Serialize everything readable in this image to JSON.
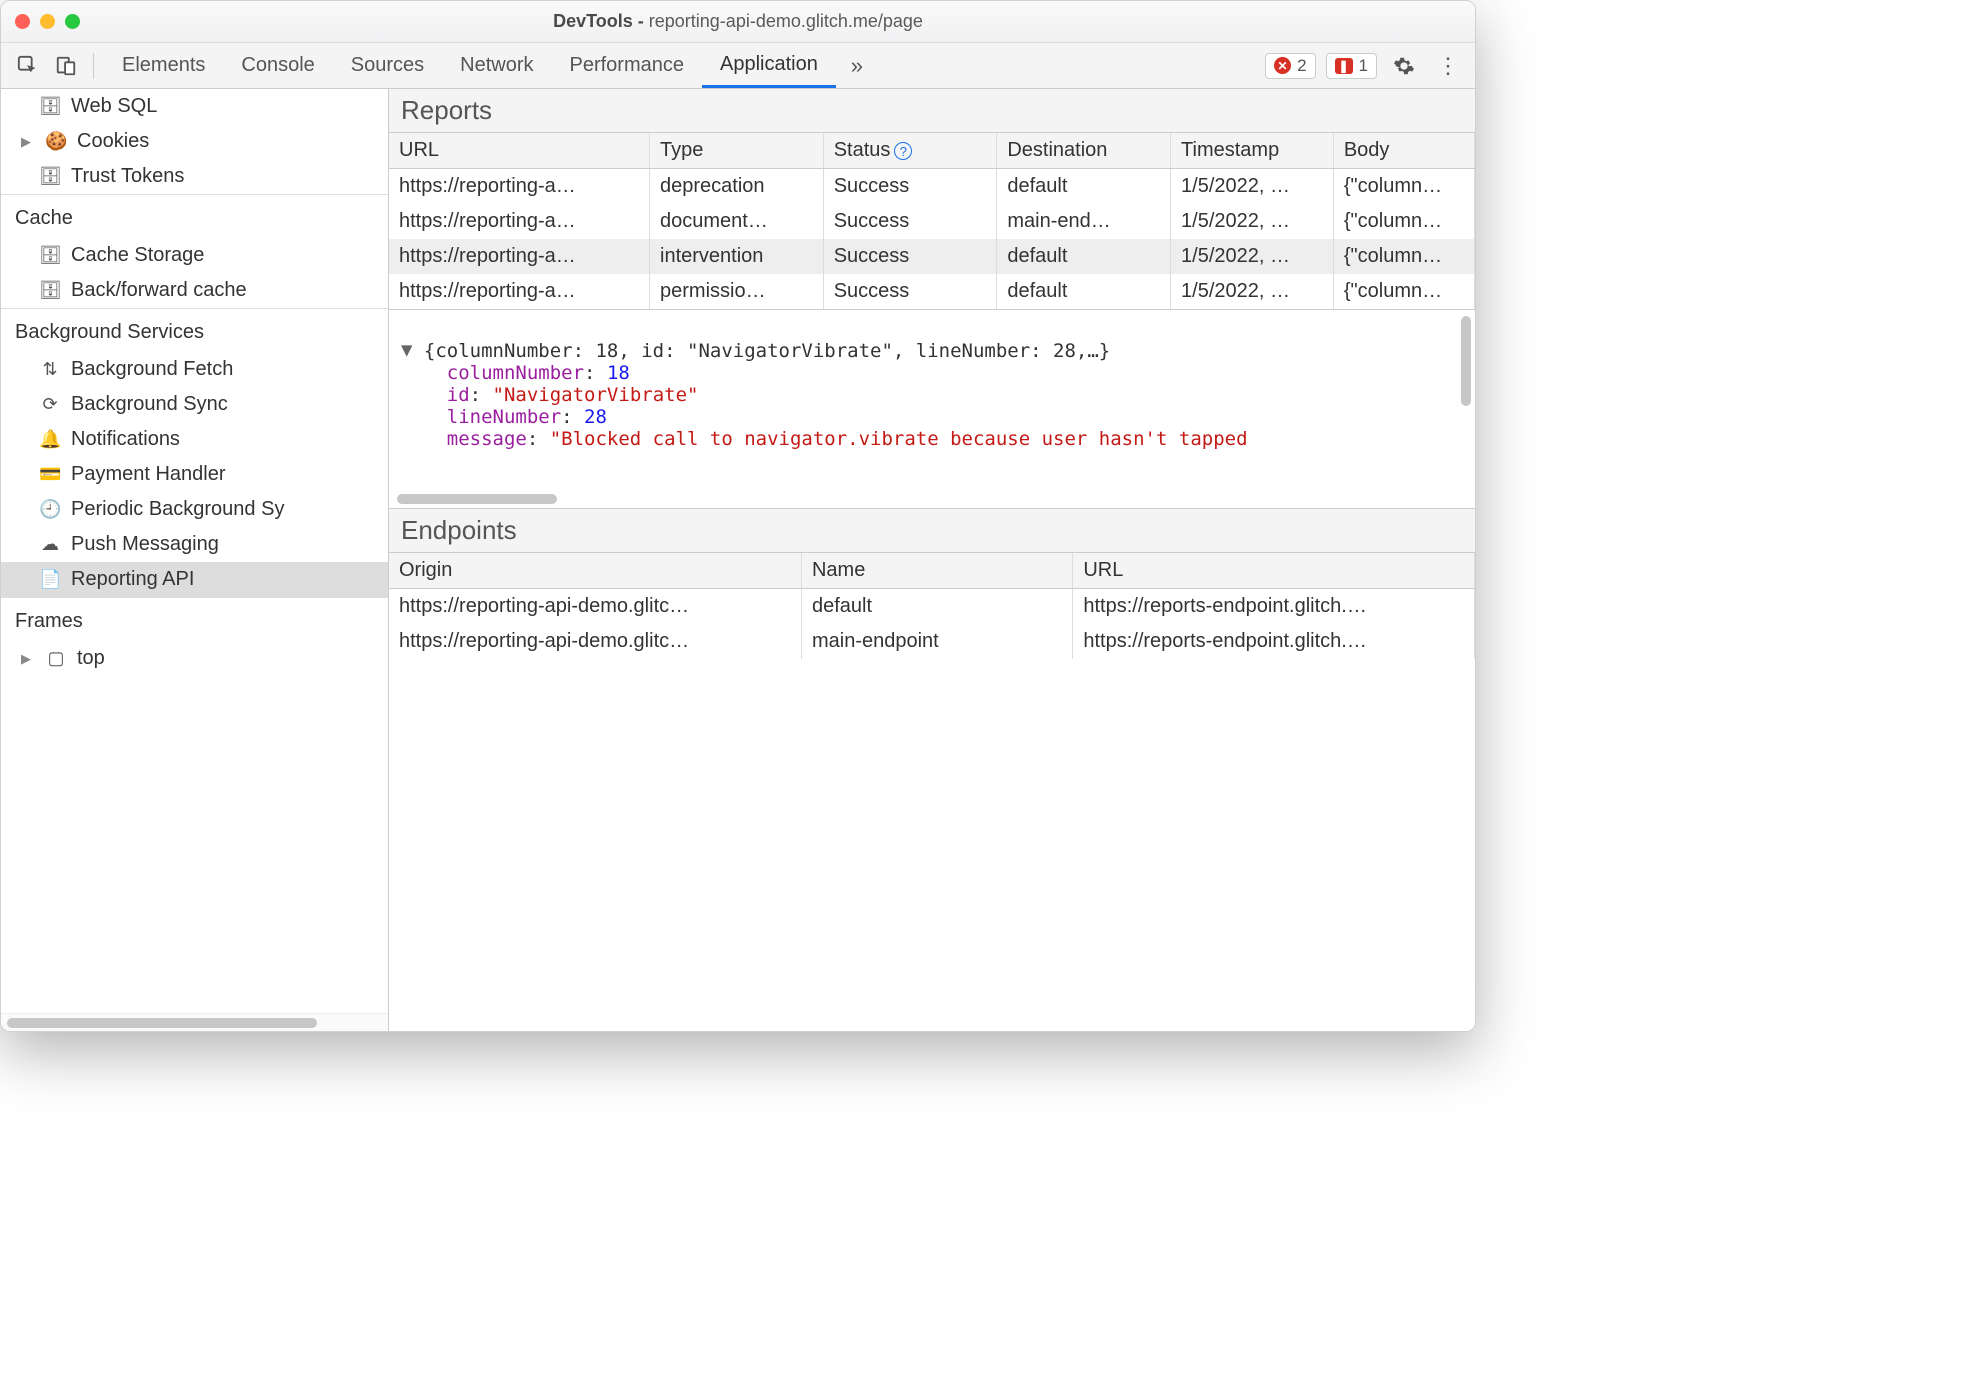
{
  "titlebar": {
    "prefix": "DevTools - ",
    "url": "reporting-api-demo.glitch.me/page"
  },
  "toolbar": {
    "tabs": [
      "Elements",
      "Console",
      "Sources",
      "Network",
      "Performance",
      "Application"
    ],
    "active_tab": "Application",
    "errors_count": "2",
    "issues_count": "1"
  },
  "sidebar": {
    "storage_items": [
      {
        "icon": "db",
        "label": "Web SQL",
        "disc": false
      },
      {
        "icon": "cookie",
        "label": "Cookies",
        "disc": true
      },
      {
        "icon": "db",
        "label": "Trust Tokens",
        "disc": false
      }
    ],
    "cache_title": "Cache",
    "cache_items": [
      {
        "icon": "db",
        "label": "Cache Storage"
      },
      {
        "icon": "db",
        "label": "Back/forward cache"
      }
    ],
    "bgs_title": "Background Services",
    "bgs_items": [
      {
        "icon": "updown",
        "label": "Background Fetch"
      },
      {
        "icon": "sync",
        "label": "Background Sync"
      },
      {
        "icon": "bell",
        "label": "Notifications"
      },
      {
        "icon": "card",
        "label": "Payment Handler"
      },
      {
        "icon": "clock",
        "label": "Periodic Background Sy"
      },
      {
        "icon": "cloud",
        "label": "Push Messaging"
      },
      {
        "icon": "page",
        "label": "Reporting API",
        "selected": true
      }
    ],
    "frames_title": "Frames",
    "frames_items": [
      {
        "icon": "frame",
        "label": "top",
        "disc": true
      }
    ]
  },
  "reports": {
    "title": "Reports",
    "columns": [
      "URL",
      "Type",
      "Status",
      "Destination",
      "Timestamp",
      "Body"
    ],
    "rows": [
      {
        "url": "https://reporting-a…",
        "type": "deprecation",
        "status": "Success",
        "dest": "default",
        "ts": "1/5/2022, …",
        "body": "{\"column…"
      },
      {
        "url": "https://reporting-a…",
        "type": "document…",
        "status": "Success",
        "dest": "main-end…",
        "ts": "1/5/2022, …",
        "body": "{\"column…"
      },
      {
        "url": "https://reporting-a…",
        "type": "intervention",
        "status": "Success",
        "dest": "default",
        "ts": "1/5/2022, …",
        "body": "{\"column…",
        "selected": true
      },
      {
        "url": "https://reporting-a…",
        "type": "permissio…",
        "status": "Success",
        "dest": "default",
        "ts": "1/5/2022, …",
        "body": "{\"column…"
      }
    ]
  },
  "inspector": {
    "summary": "{columnNumber: 18, id: \"NavigatorVibrate\", lineNumber: 28,…}",
    "props": {
      "columnNumber": "18",
      "id": "\"NavigatorVibrate\"",
      "lineNumber": "28",
      "message": "\"Blocked call to navigator.vibrate because user hasn't tapped"
    }
  },
  "endpoints": {
    "title": "Endpoints",
    "columns": [
      "Origin",
      "Name",
      "URL"
    ],
    "rows": [
      {
        "origin": "https://reporting-api-demo.glitc…",
        "name": "default",
        "url": "https://reports-endpoint.glitch.…"
      },
      {
        "origin": "https://reporting-api-demo.glitc…",
        "name": "main-endpoint",
        "url": "https://reports-endpoint.glitch.…"
      }
    ]
  }
}
